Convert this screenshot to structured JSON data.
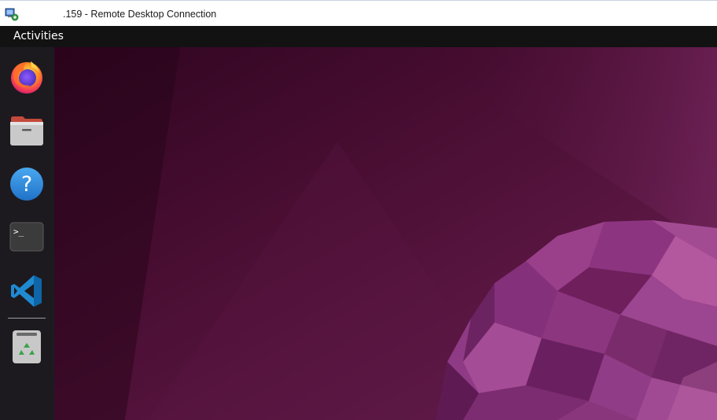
{
  "window": {
    "title": ".159 - Remote Desktop Connection"
  },
  "topbar": {
    "activities_label": "Activities"
  },
  "dock": {
    "items": [
      {
        "app": "firefox",
        "icon": "firefox-icon"
      },
      {
        "app": "files",
        "icon": "files-folder-icon"
      },
      {
        "app": "help",
        "icon": "help-icon"
      },
      {
        "app": "terminal",
        "icon": "terminal-icon",
        "glyph": ">_"
      },
      {
        "app": "vscode",
        "icon": "vscode-icon"
      },
      {
        "app": "trash",
        "icon": "trash-icon"
      }
    ]
  },
  "colors": {
    "topbar": "#121212",
    "dock": "#1d1a1f",
    "wallpaper_dark": "#2c001e",
    "wallpaper_mid": "#5e1a46",
    "wallpaper_accent": "#9b3e8a"
  }
}
